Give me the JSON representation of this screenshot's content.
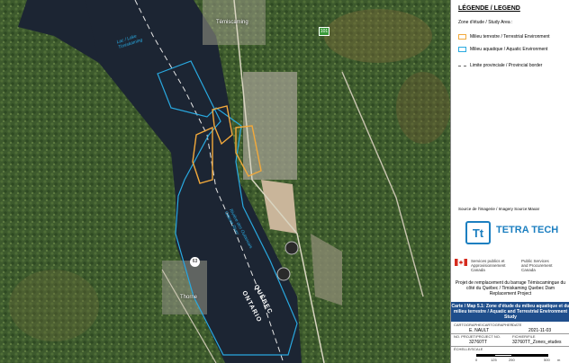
{
  "map": {
    "places": {
      "temiscaming": "Témiscaming",
      "thorne": "Thorne",
      "lake": "Lac / Lake\nTimiskaming",
      "river": "Rivière des Outaouais\nOttawa River"
    },
    "provinces": {
      "quebec": "QUÉBEC",
      "ontario": "ONTARIO"
    },
    "route_63": "63",
    "route_101": "101",
    "colors": {
      "terrestrial": "#f2a93b",
      "aquatic": "#29a9e0",
      "water": "#1c2533",
      "forest": "#3e5a2c"
    }
  },
  "legend": {
    "title": "LÉGENDE / LEGEND",
    "study_area": "Zone d'étude / Study Area :",
    "terrestrial": "Milieu terrestre / Terrestrial Environment",
    "aquatic": "Milieu aquatique / Aquatic Environment",
    "border": "Limite provinciale / Provincial border"
  },
  "source": "Source de l'imagerie / Imagery Source:Maxar",
  "logo": {
    "mark": "Tt",
    "name": "TETRA TECH"
  },
  "government": {
    "fr": "Services publics et\nApprovisionnement\nCanada",
    "en": "Public Services\nand Procurement\nCanada"
  },
  "project": "Projet de remplacement du barrage Témiscamingue du côté du Québec / Timiskaming Quebec Dam Replacement Project",
  "map_title": "Carte / Map 5.1: Zone d'étude du milieu aquatique et du milieu terrestre / Aquatic and Terrestrial Environment Study",
  "titleblock": {
    "cartographer_label": "CARTOGRAPHE/CARTOGRAPHER",
    "cartographer": "E. NAULT",
    "date_label": "DATE",
    "date": "2021-11-03",
    "project_no_label": "NO. PROJET/PROJECT NO.",
    "project_no": "32760TT",
    "file_label": "FICHIER/FILE",
    "file": "32760TT_Zones_etudes",
    "scale_label": "ÉCHELLE/SCALE",
    "scale_ticks": [
      "0",
      "125",
      "250",
      "500"
    ],
    "scale_unit": "m"
  }
}
